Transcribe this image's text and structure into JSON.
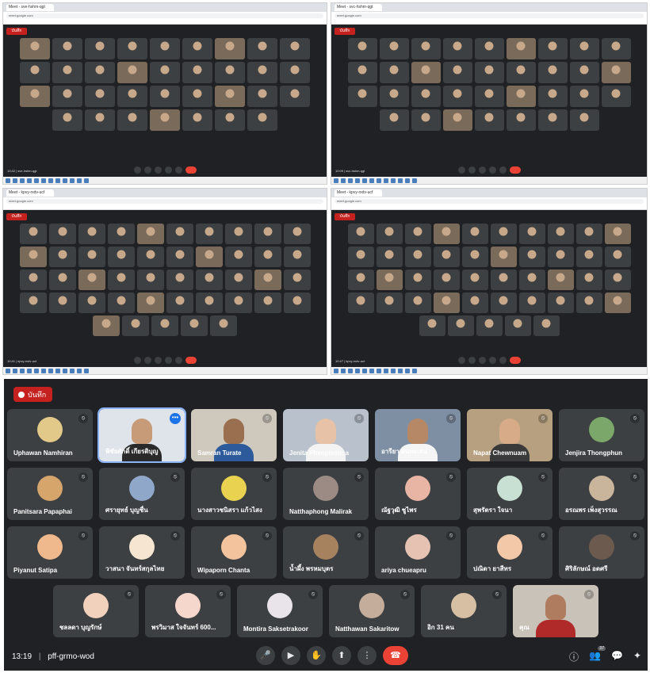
{
  "panes": [
    {
      "tab": "Meet - sve-hshm-qgt",
      "time": "13:42",
      "meeting": "sve-hshm-qgt"
    },
    {
      "tab": "Meet - svc-hshm-qgt",
      "time": "10:09",
      "meeting": "svc-hshm-qgt"
    },
    {
      "tab": "Meet - kpvy-rxdv-ucf",
      "time": "10:41",
      "meeting": "kpvy-rxdv-ucf"
    },
    {
      "tab": "Meet - kpvy-rxdv-ucf",
      "time": "10:47",
      "meeting": "kpvy-rxdv-ucf"
    }
  ],
  "url_text": "meet.google.com",
  "rec_small": "บันทึก",
  "main": {
    "rec_label": "บันทึก",
    "rows": [
      [
        {
          "name": "Uphawan Namhiran",
          "type": "avatar",
          "color": "#e2c98a"
        },
        {
          "name": "พิชัยศักดิ์ เกียรติบุญ",
          "type": "video",
          "active": true,
          "skin": "#c79a78",
          "bg": "#dfe3ea",
          "shirt": "#2a2a2a"
        },
        {
          "name": "Samran Turate",
          "type": "video",
          "skin": "#9a6f4f",
          "bg": "#cfc8bd",
          "shirt": "#2d5a9a"
        },
        {
          "name": "Jenita Phenpisonsa",
          "type": "video",
          "skin": "#e7c2a7",
          "bg": "#b8c1cc",
          "shirt": "#f3f3f3"
        },
        {
          "name": "อารียา อินทะเสน",
          "type": "video",
          "skin": "#b68866",
          "bg": "#7f8fa3",
          "shirt": "#f5f5f5"
        },
        {
          "name": "Napat Chewnuam",
          "type": "video",
          "skin": "#d8ab88",
          "bg": "#b7a080",
          "shirt": "#3a3a3a"
        },
        {
          "name": "Jenjira Thongphun",
          "type": "avatar",
          "color": "#7ba86a"
        }
      ],
      [
        {
          "name": "Panitsara Papaphai",
          "type": "avatar",
          "color": "#d5a56c"
        },
        {
          "name": "ศรายุทธ์ บุญชื่น",
          "type": "avatar",
          "color": "#8fa7c9"
        },
        {
          "name": "นางสาวชนิสรา แก้วไสง",
          "type": "avatar",
          "color": "#e9d24f"
        },
        {
          "name": "Natthaphong Malirak",
          "type": "avatar",
          "color": "#9b8b84"
        },
        {
          "name": "ณัฐวุฒิ ชูไพร",
          "type": "avatar",
          "color": "#e8b4a4"
        },
        {
          "name": "สุพรัตรา ใจนา",
          "type": "avatar",
          "color": "#c7e0d3"
        },
        {
          "name": "อรณพร เพ็งสุวรรณ",
          "type": "avatar",
          "color": "#c9b49c"
        }
      ],
      [
        {
          "name": "Piyanut Satipa",
          "type": "avatar",
          "color": "#f0b98d"
        },
        {
          "name": "วาสนา จันทร์สกุลไทย",
          "type": "avatar",
          "color": "#f6e6d1"
        },
        {
          "name": "Wipaporn Chanta",
          "type": "avatar",
          "color": "#f2c39c"
        },
        {
          "name": "น้ำผึ้ง พรหมบุตร",
          "type": "avatar",
          "color": "#a7825f"
        },
        {
          "name": "ariya chueapru",
          "type": "avatar",
          "color": "#e6c2b2"
        },
        {
          "name": "ปณิดา ยาสีทร",
          "type": "avatar",
          "color": "#f3c8a8"
        },
        {
          "name": "ศิริลักษณ์ อดศรี",
          "type": "avatar",
          "color": "#6d5a4f"
        }
      ],
      [
        {
          "name": "ชลลดา บุญรักษ์",
          "type": "avatar",
          "color": "#f1d0bc"
        },
        {
          "name": "พรวิมาส ใจจันทร์ 600...",
          "type": "avatar",
          "color": "#f5d7cb"
        },
        {
          "name": "Montira Saksetrakoon",
          "type": "avatar",
          "color": "#e9e4ea"
        },
        {
          "name": "Natthawan Sakaritow",
          "type": "avatar",
          "color": "#c4ad9a"
        },
        {
          "name": "อิก 31 คน",
          "type": "avatar",
          "color": "#d7bfa4"
        },
        {
          "name": "คุณ",
          "type": "video",
          "skin": "#b07c5f",
          "bg": "#c9c2b8",
          "shirt": "#b02a2a"
        }
      ]
    ],
    "clock": "13:19",
    "meeting_code": "pff-grmo-wod",
    "participants_badge": "37"
  }
}
